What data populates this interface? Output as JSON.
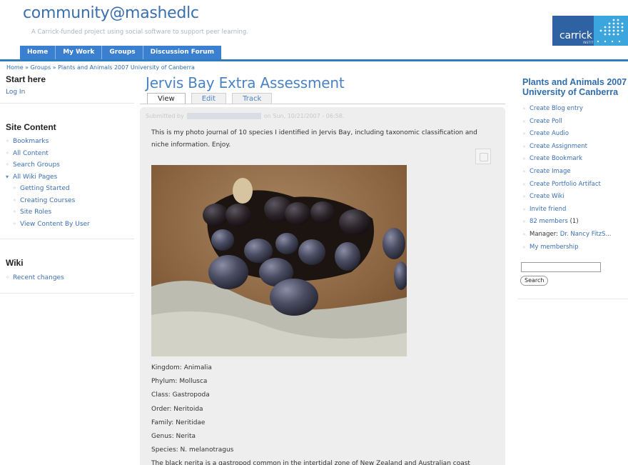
{
  "header": {
    "site_name": "community@mashedlc",
    "slogan": "A Carrick-funded project using social software to support peer learning.",
    "logo_text": "carrick",
    "logo_subtext": "INSTITUTE"
  },
  "nav": [
    "Home",
    "My Work",
    "Groups",
    "Discussion Forum"
  ],
  "breadcrumb": "Home » Groups » Plants and Animals 2007 University of Canberra",
  "left": {
    "start_here": {
      "title": "Start here",
      "login": "Log In"
    },
    "site_content": {
      "title": "Site Content",
      "items": [
        "Bookmarks",
        "All Content",
        "Search Groups",
        "All Wiki Pages"
      ],
      "subitems": [
        "Getting Started",
        "Creating Courses",
        "Site Roles",
        "View Content By User"
      ]
    },
    "wiki": {
      "title": "Wiki",
      "items": [
        "Recent changes"
      ]
    }
  },
  "main": {
    "title": "Jervis Bay Extra Assessment",
    "tabs": [
      "View",
      "Edit",
      "Track"
    ],
    "submitted_prefix": "Submitted by",
    "submitted_date": "on Sun, 10/21/2007 - 06:58.",
    "intro": "This is my photo journal of 10 species I identified in Jervis Bay, including taxonomic classification and niche information. Enjoy.",
    "taxonomy": [
      "Kingdom: Animalia",
      "Phylum: Mollusca",
      "Class: Gastropoda",
      "Order: Neritoida",
      "Family: Neritidae",
      "Genus: Nerita",
      "Species: N. melanotragus",
      "The black nerita is a gastropod common in the intertidal zone of New Zealand and Australian coast"
    ]
  },
  "right": {
    "title": "Plants and Animals 2007 University of Canberra",
    "items": [
      "Create Blog entry",
      "Create Poll",
      "Create Audio",
      "Create Assignment",
      "Create Bookmark",
      "Create Image",
      "Create Portfolio Artifact",
      "Create Wiki",
      "Invite friend"
    ],
    "members_link": "82 members",
    "members_count": "(1)",
    "manager_label": "Manager:",
    "manager_name": "Dr. Nancy FitzS...",
    "membership": "My membership",
    "search_button": "Search"
  },
  "colors": {
    "link": "#3b6fb5",
    "nav": "#3a7fd0",
    "title": "#4a83c4"
  }
}
